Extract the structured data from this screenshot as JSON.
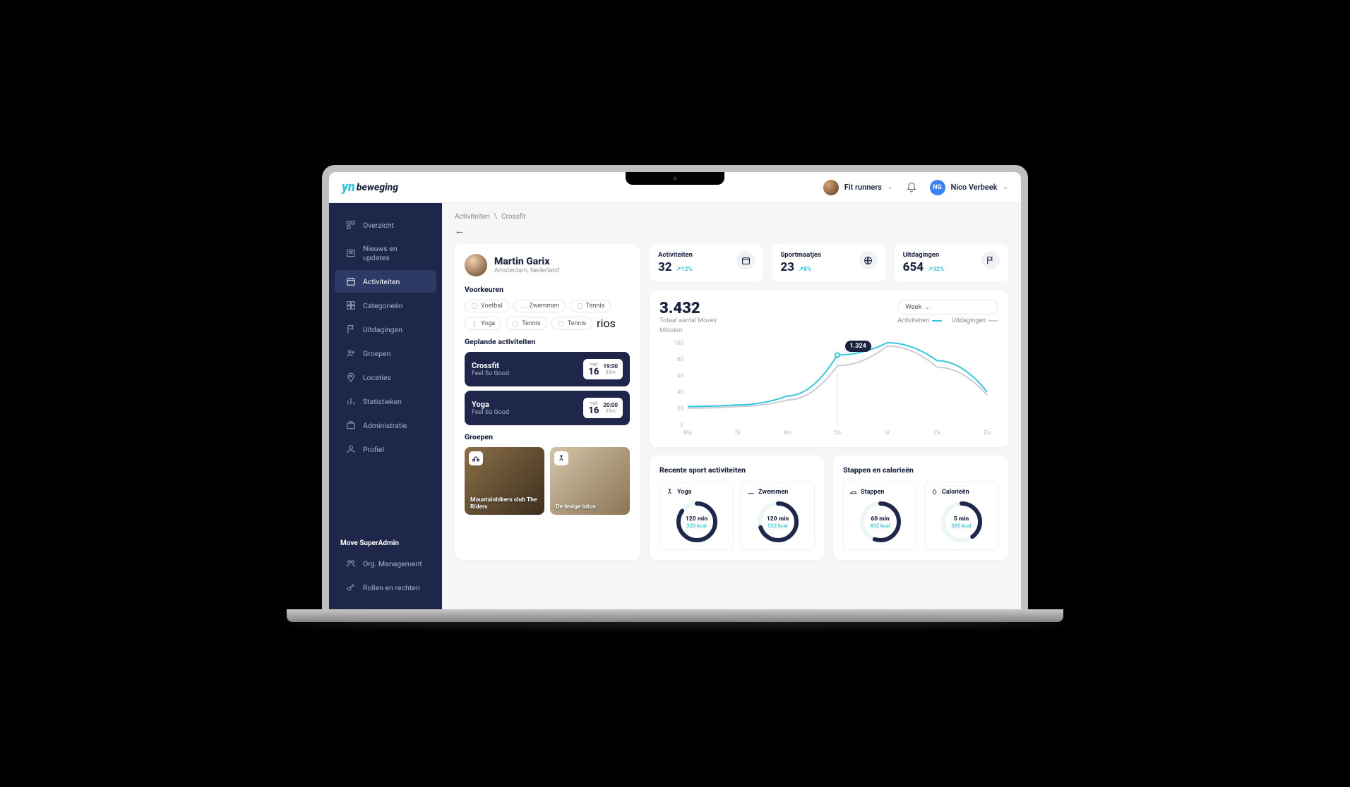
{
  "brand": {
    "mark": "yn",
    "text": "beweging"
  },
  "topbar": {
    "team_name": "Fit runners",
    "user_initials": "NG",
    "user_name": "Nico Verbeek"
  },
  "sidebar": {
    "items": [
      {
        "label": "Overzicht"
      },
      {
        "label": "Nieuws en updates"
      },
      {
        "label": "Activiteiten"
      },
      {
        "label": "Categorieën"
      },
      {
        "label": "Uitdagingen"
      },
      {
        "label": "Groepen"
      },
      {
        "label": "Locaties"
      },
      {
        "label": "Statistieken"
      },
      {
        "label": "Administratie"
      },
      {
        "label": "Profiel"
      }
    ],
    "section_label": "Move SuperAdmin",
    "admin_items": [
      {
        "label": "Org. Management"
      },
      {
        "label": "Rollen en rechten"
      }
    ]
  },
  "breadcrumb": {
    "parent": "Activiteiten",
    "sep": "\\",
    "current": "Crossfit"
  },
  "profile": {
    "name": "Martin Garix",
    "location": "Amsterdam, Nederland",
    "prefs_label": "Voorkeuren",
    "prefs": [
      "Voetbal",
      "Zwemmen",
      "Tennis",
      "Yoga",
      "Tennis",
      "Tennis"
    ],
    "planned_label": "Geplande activiteiten",
    "planned": [
      {
        "title": "Crossfit",
        "sub": "Feel So Good",
        "month": "mei",
        "day": "16",
        "time": "19:00",
        "dur": "30m"
      },
      {
        "title": "Yoga",
        "sub": "Feel So Good",
        "month": "mei",
        "day": "16",
        "time": "20:00",
        "dur": "30m"
      }
    ],
    "groups_label": "Groepen",
    "groups": [
      {
        "title": "Mountainbikers club The Riders"
      },
      {
        "title": "De lenige lotus"
      }
    ]
  },
  "stats": [
    {
      "label": "Activiteiten",
      "value": "32",
      "trend": "↗12%"
    },
    {
      "label": "Sportmaatjes",
      "value": "23",
      "trend": "↗8%"
    },
    {
      "label": "Uitdagingen",
      "value": "654",
      "trend": "↗32%"
    }
  ],
  "chart": {
    "value": "3.432",
    "sub": "Totaal aantal Moves",
    "ylabel": "Minuten",
    "period": "Week",
    "legend": {
      "a": "Activiteiten",
      "b": "Uitdagingen"
    },
    "tooltip": "1.324"
  },
  "chart_data": {
    "type": "line",
    "categories": [
      "Ma",
      "Di",
      "Wo",
      "Do",
      "Vr",
      "Za",
      "Zo"
    ],
    "ylim": [
      0,
      100
    ],
    "yticks": [
      0,
      20,
      40,
      60,
      80,
      100
    ],
    "series": [
      {
        "name": "Activiteiten",
        "color": "#35c6d9",
        "values": [
          22,
          24,
          35,
          85,
          100,
          78,
          40
        ]
      },
      {
        "name": "Uitdagingen",
        "color": "#c8cdd8",
        "values": [
          20,
          22,
          30,
          72,
          96,
          70,
          36
        ]
      }
    ]
  },
  "recent": {
    "title": "Recente sport activiteiten",
    "items": [
      {
        "label": "Yoga",
        "v1": "120 min",
        "v2": "320 kcal",
        "pct": 85
      },
      {
        "label": "Zwemmen",
        "v1": "120 min",
        "v2": "532 kcal",
        "pct": 70
      }
    ]
  },
  "steps": {
    "title": "Stappen en calorieën",
    "items": [
      {
        "label": "Stappen",
        "v1": "60 min",
        "v2": "432 kcal",
        "pct": 55
      },
      {
        "label": "Calorieën",
        "v1": "5 min",
        "v2": "320 kcal",
        "pct": 40
      }
    ]
  }
}
